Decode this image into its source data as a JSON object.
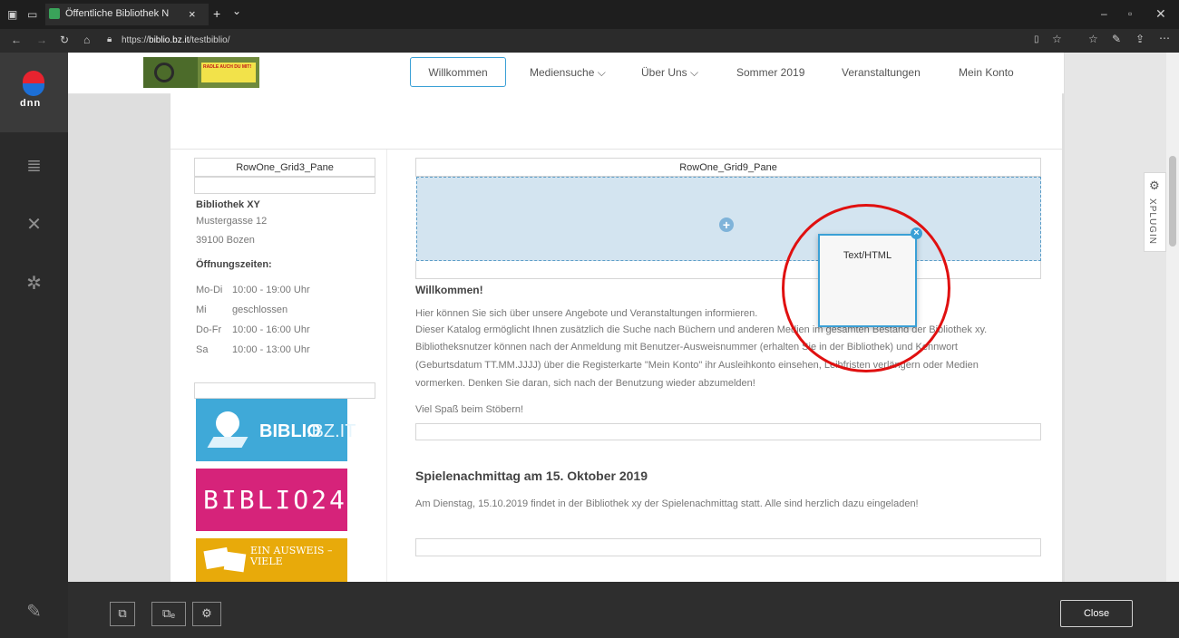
{
  "browser": {
    "tab_title": "Öffentliche Bibliothek N",
    "tab_close": "×",
    "new_tab": "+",
    "tab_menu": "⌄",
    "url_prefix": "https://",
    "url_host": "biblio.bz.it",
    "url_path": "/testbiblio/"
  },
  "persona_bar": {
    "logo_text": "DNN",
    "items": [
      "content-icon",
      "tools-icon",
      "settings-icon",
      "edit-icon"
    ]
  },
  "banner": {
    "text": "RADLE AUCH DU MIT!"
  },
  "nav": {
    "items": [
      {
        "label": "Willkommen",
        "active": true
      },
      {
        "label": "Mediensuche ⌵"
      },
      {
        "label": "Über Uns ⌵"
      },
      {
        "label": "Sommer 2019"
      },
      {
        "label": "Veranstaltungen"
      },
      {
        "label": "Mein Konto"
      }
    ]
  },
  "left_pane": {
    "label": "RowOne_Grid3_Pane",
    "library_name": "Bibliothek XY",
    "street": "Mustergasse 12",
    "city": "39100 Bozen",
    "hours_title": "Öffnungszeiten:",
    "hours": [
      {
        "day": "Mo-Di",
        "time": "10:00 - 19:00 Uhr"
      },
      {
        "day": "Mi",
        "time": "geschlossen"
      },
      {
        "day": "Do-Fr",
        "time": "10:00 - 16:00 Uhr"
      },
      {
        "day": "Sa",
        "time": "10:00 - 13:00 Uhr"
      }
    ],
    "logos": {
      "biblio_bold": "BIBLIO",
      "biblio_light": ".BZ.IT",
      "biblio24": "BIBLIO24",
      "ausweis": "EIN AUSWEIS – VIELE"
    }
  },
  "main_pane": {
    "label": "RowOne_Grid9_Pane",
    "drop_icon": "+",
    "welcome_title": "Willkommen!",
    "welcome_lines": [
      "Hier können Sie sich über unsere Angebote und Veranstaltungen informieren.",
      "Dieser Katalog ermöglicht Ihnen zusätzlich die Suche nach Büchern und anderen Medien im gesamten Bestand der Bibliothek xy.",
      "Bibliotheksnutzer können nach der Anmeldung mit Benutzer-Ausweisnummer (erhalten Sie in der Bibliothek) und Kennwort",
      "(Geburtsdatum TT.MM.JJJJ) über die Registerkarte \"Mein Konto\" ihr Ausleihkonto einsehen, Leihfristen verlängern oder Medien",
      "vormerken. Denken Sie daran, sich nach der Benutzung wieder abzumelden!"
    ],
    "welcome_footer": "Viel Spaß beim Stöbern!",
    "event_title": "Spielenachmittag am 15. Oktober 2019",
    "event_text": "Am Dienstag, 15.10.2019 findet in der Bibliothek xy der Spielenachmittag statt. Alle sind herzlich dazu eingeladen!"
  },
  "module_card": {
    "label": "Text/HTML",
    "close": "×"
  },
  "xplugin": {
    "label": "XPLUGIN"
  },
  "bottom_bar": {
    "close_label": "Close"
  },
  "colors": {
    "accent": "#3aa0d6",
    "drop_zone": "#d3e4f0",
    "highlight_circle": "#e01010",
    "biblio_blue": "#3fa9d8",
    "biblio24_pink": "#d6237a",
    "ausweis_yellow": "#e8aa0a"
  }
}
